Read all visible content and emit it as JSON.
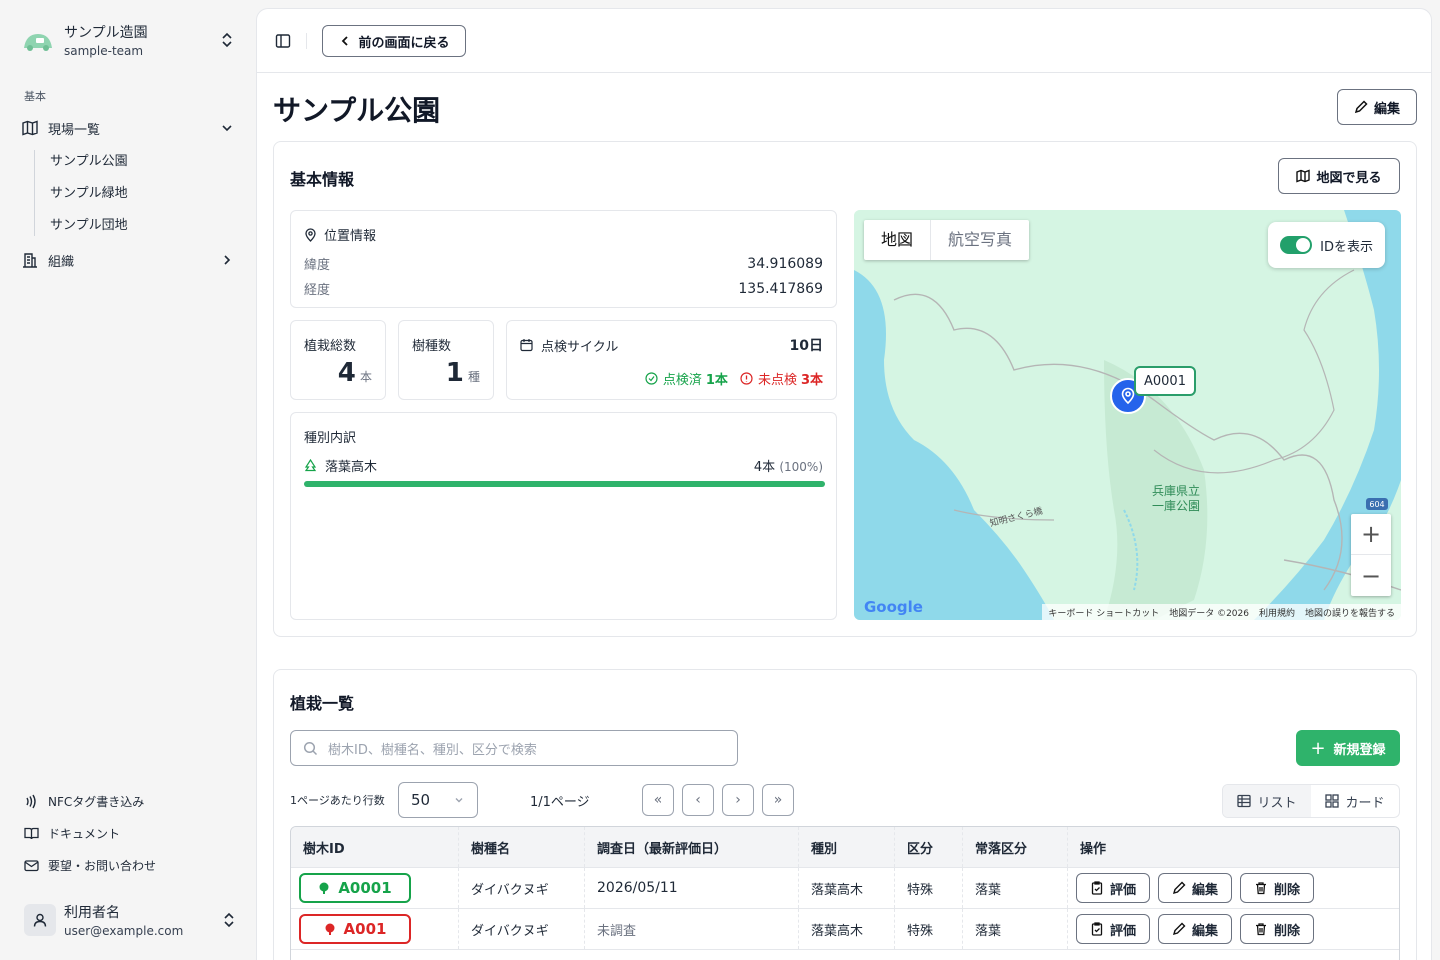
{
  "team": {
    "name": "サンプル造園",
    "slug": "sample-team"
  },
  "sidebar": {
    "section_label": "基本",
    "sites_label": "現場一覧",
    "sites": [
      "サンプル公園",
      "サンプル緑地",
      "サンプル団地"
    ],
    "org_label": "組織",
    "footer": {
      "nfc": "NFCタグ書き込み",
      "docs": "ドキュメント",
      "contact": "要望・お問い合わせ"
    },
    "user": {
      "name": "利用者名",
      "email": "user@example.com"
    }
  },
  "topbar": {
    "back_label": "前の画面に戻る"
  },
  "page": {
    "title": "サンプル公園",
    "edit_label": "編集"
  },
  "basic": {
    "title": "基本情報",
    "map_button": "地図で見る",
    "location": {
      "label": "位置情報",
      "lat_label": "緯度",
      "lat": "34.916089",
      "lng_label": "経度",
      "lng": "135.417869"
    },
    "planted": {
      "label": "植栽総数",
      "value": "4",
      "unit": "本"
    },
    "species": {
      "label": "樹種数",
      "value": "1",
      "unit": "種"
    },
    "cycle": {
      "label": "点検サイクル",
      "value": "10日",
      "done_label": "点検済",
      "done_value": "1本",
      "undone_label": "未点検",
      "undone_value": "3本"
    },
    "breakdown": {
      "label": "種別内訳",
      "items": [
        {
          "name": "落葉高木",
          "count": "4本",
          "pct": "(100%)",
          "ratio": 1.0
        }
      ]
    }
  },
  "map": {
    "tab_map": "地図",
    "tab_aerial": "航空写真",
    "toggle_label": "IDを表示",
    "marker_label": "A0001",
    "park_label_1": "兵庫県立",
    "park_label_2": "一庫公園",
    "road_label": "知明さくら橋",
    "route_label": "604",
    "logo": "Google",
    "attrib": [
      "キーボード ショートカット",
      "地図データ ©2026",
      "利用規約",
      "地図の誤りを報告する"
    ],
    "zoom_in": "+",
    "zoom_out": "−"
  },
  "plants": {
    "title": "植栽一覧",
    "search_placeholder": "樹木ID、樹種名、種別、区分で検索",
    "add_label": "新規登録",
    "per_page_label": "1ページあたり行数",
    "per_page_value": "50",
    "page_info": "1/1ページ",
    "view_list": "リスト",
    "view_card": "カード",
    "columns": [
      "樹木ID",
      "樹種名",
      "調査日（最新評価日）",
      "種別",
      "区分",
      "常落区分",
      "操作"
    ],
    "rows": [
      {
        "id": "A0001",
        "species": "ダイバクヌギ",
        "date": "2026/05/11",
        "type": "落葉高木",
        "class": "特殊",
        "leaf": "落葉",
        "status_color": "#16a34a"
      },
      {
        "id": "A001",
        "species": "ダイバクヌギ",
        "date": "未調査",
        "type": "落葉高木",
        "class": "特殊",
        "leaf": "落葉",
        "status_color": "#dc2626"
      }
    ],
    "actions": {
      "evaluate": "評価",
      "edit": "編集",
      "delete": "削除"
    }
  },
  "colors": {
    "accent": "#2fb36b",
    "danger": "#dc2626",
    "success": "#16a34a",
    "pin": "#2563eb"
  }
}
